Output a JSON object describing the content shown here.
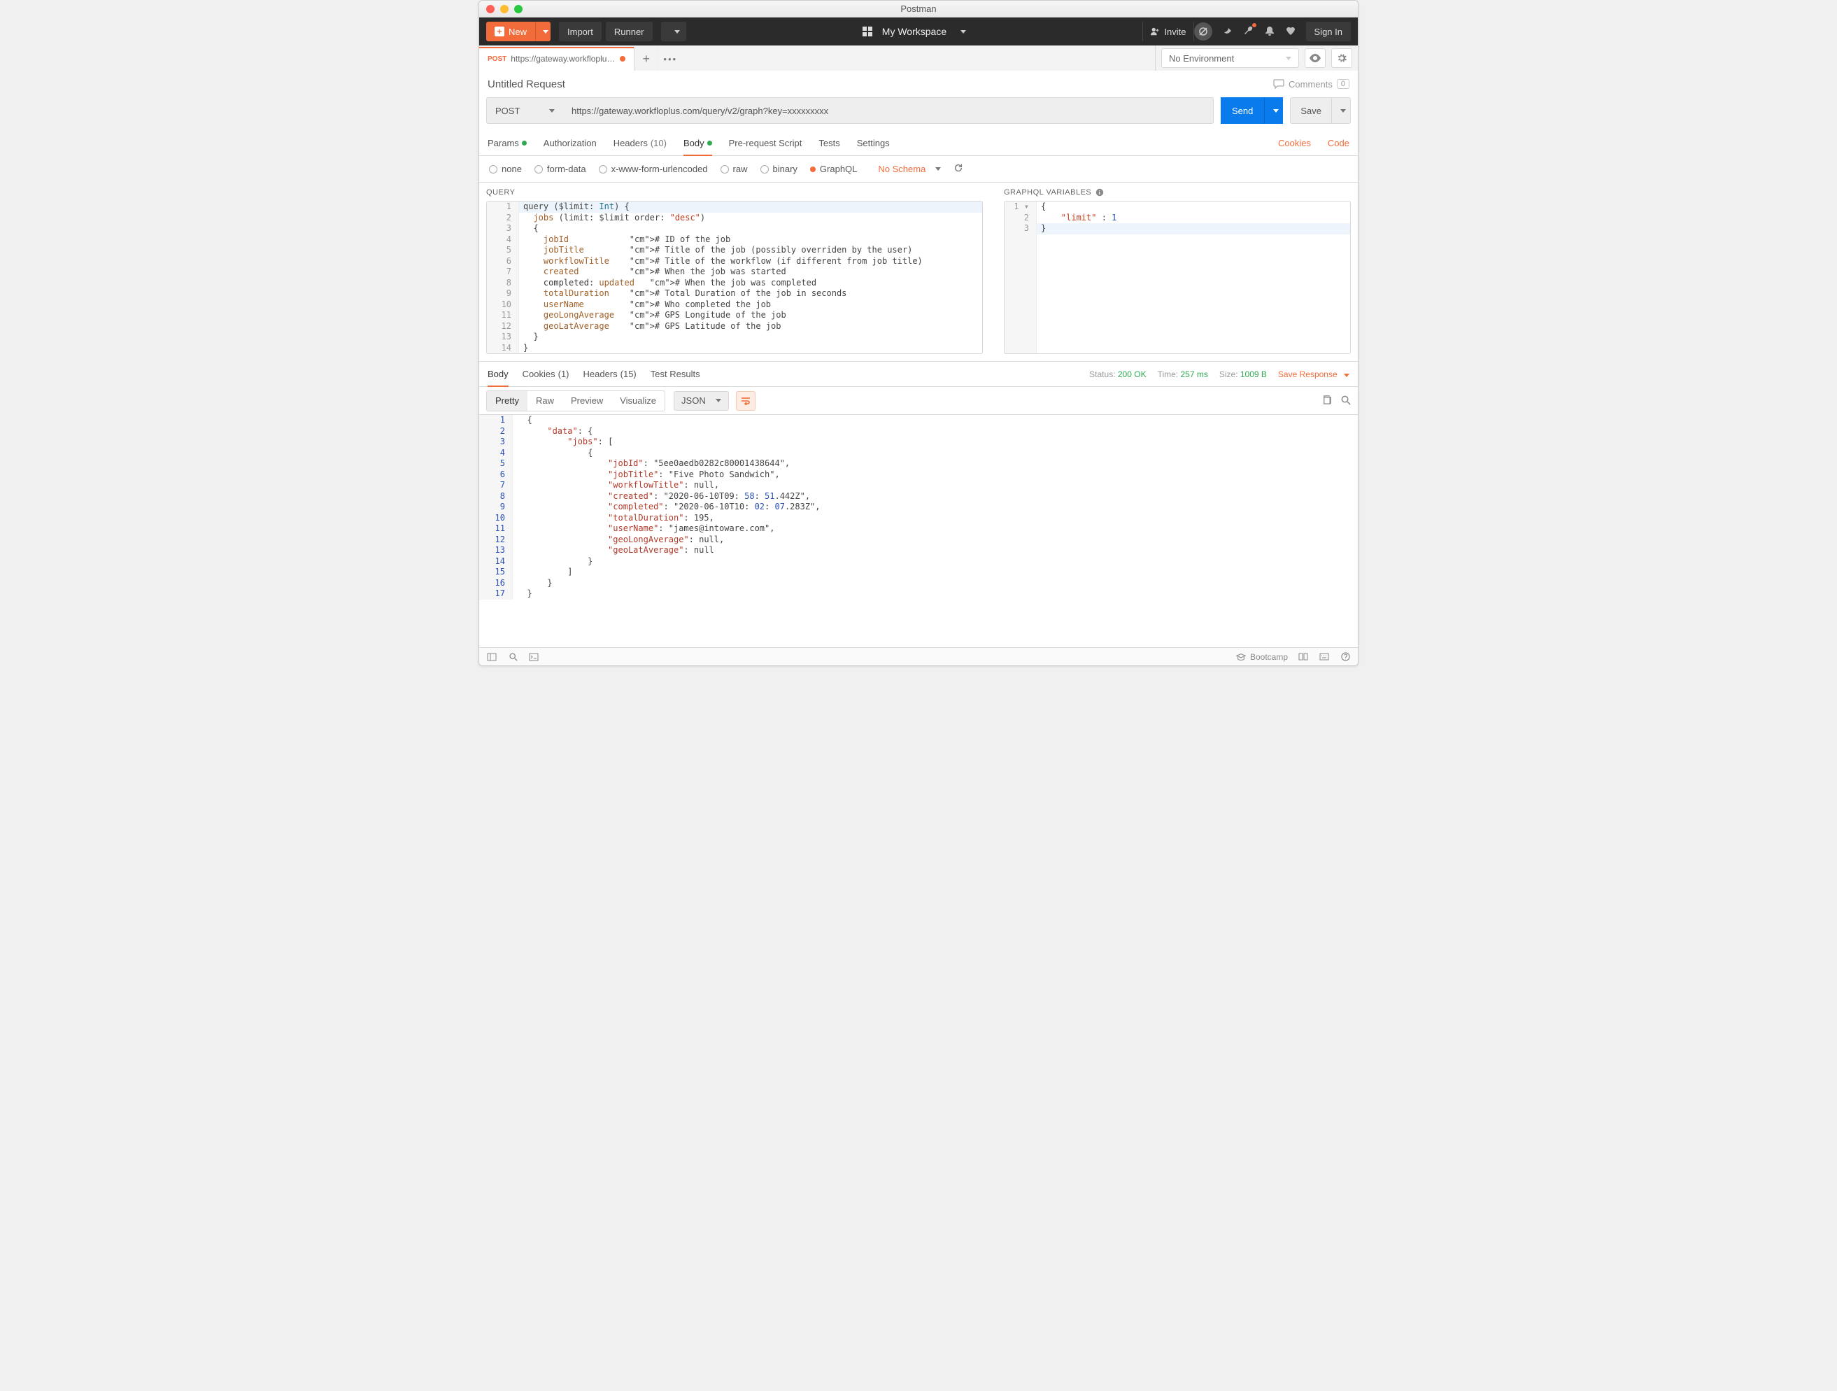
{
  "window_title": "Postman",
  "header": {
    "new_label": "New",
    "import_label": "Import",
    "runner_label": "Runner",
    "workspace_label": "My Workspace",
    "invite_label": "Invite",
    "signin_label": "Sign In"
  },
  "tab": {
    "method": "POST",
    "label": "https://gateway.workfloplus.c..."
  },
  "env": {
    "selected": "No Environment"
  },
  "request": {
    "title": "Untitled Request",
    "comments_label": "Comments",
    "comments_count": "0",
    "method": "POST",
    "url": "https://gateway.workfloplus.com/query/v2/graph?key=xxxxxxxxx",
    "send_label": "Send",
    "save_label": "Save"
  },
  "req_tabs": {
    "params": "Params",
    "auth": "Authorization",
    "headers": "Headers",
    "headers_count": "(10)",
    "body": "Body",
    "prereq": "Pre-request Script",
    "tests": "Tests",
    "settings": "Settings",
    "cookies": "Cookies",
    "code": "Code"
  },
  "body_types": {
    "none": "none",
    "formdata": "form-data",
    "xwww": "x-www-form-urlencoded",
    "raw": "raw",
    "binary": "binary",
    "graphql": "GraphQL",
    "no_schema": "No Schema"
  },
  "query_title": "QUERY",
  "vars_title": "GRAPHQL VARIABLES",
  "query_lines": [
    "query ($limit: Int) {",
    "  jobs (limit: $limit order: \"desc\")",
    "  {",
    "    jobId            # ID of the job",
    "    jobTitle         # Title of the job (possibly overriden by the user)",
    "    workflowTitle    # Title of the workflow (if different from job title)",
    "    created          # When the job was started",
    "    completed: updated   # When the job was completed",
    "    totalDuration    # Total Duration of the job in seconds",
    "    userName         # Who completed the job",
    "    geoLongAverage   # GPS Longitude of the job",
    "    geoLatAverage    # GPS Latitude of the job",
    "  }",
    "}"
  ],
  "vars_lines": [
    "{",
    "    \"limit\" : 1",
    "}"
  ],
  "resp_tabs": {
    "body": "Body",
    "cookies": "Cookies",
    "cookies_count": "(1)",
    "headers": "Headers",
    "headers_count": "(15)",
    "tests": "Test Results"
  },
  "resp_meta": {
    "status_lbl": "Status:",
    "status_val": "200 OK",
    "time_lbl": "Time:",
    "time_val": "257 ms",
    "size_lbl": "Size:",
    "size_val": "1009 B",
    "save_response": "Save Response"
  },
  "resp_toolbar": {
    "pretty": "Pretty",
    "raw": "Raw",
    "preview": "Preview",
    "visualize": "Visualize",
    "format": "JSON"
  },
  "response_json": {
    "data": {
      "jobs": [
        {
          "jobId": "5ee0aedb0282c80001438644",
          "jobTitle": "Five Photo Sandwich",
          "workflowTitle": null,
          "created": "2020-06-10T09:58:51.442Z",
          "completed": "2020-06-10T10:02:07.283Z",
          "totalDuration": 195,
          "userName": "james@intoware.com",
          "geoLongAverage": null,
          "geoLatAverage": null
        }
      ]
    }
  },
  "response_lines": [
    "{",
    "    \"data\": {",
    "        \"jobs\": [",
    "            {",
    "                \"jobId\": \"5ee0aedb0282c80001438644\",",
    "                \"jobTitle\": \"Five Photo Sandwich\",",
    "                \"workflowTitle\": null,",
    "                \"created\": \"2020-06-10T09:58:51.442Z\",",
    "                \"completed\": \"2020-06-10T10:02:07.283Z\",",
    "                \"totalDuration\": 195,",
    "                \"userName\": \"james@intoware.com\",",
    "                \"geoLongAverage\": null,",
    "                \"geoLatAverage\": null",
    "            }",
    "        ]",
    "    }",
    "}"
  ],
  "statusbar": {
    "bootcamp": "Bootcamp"
  }
}
